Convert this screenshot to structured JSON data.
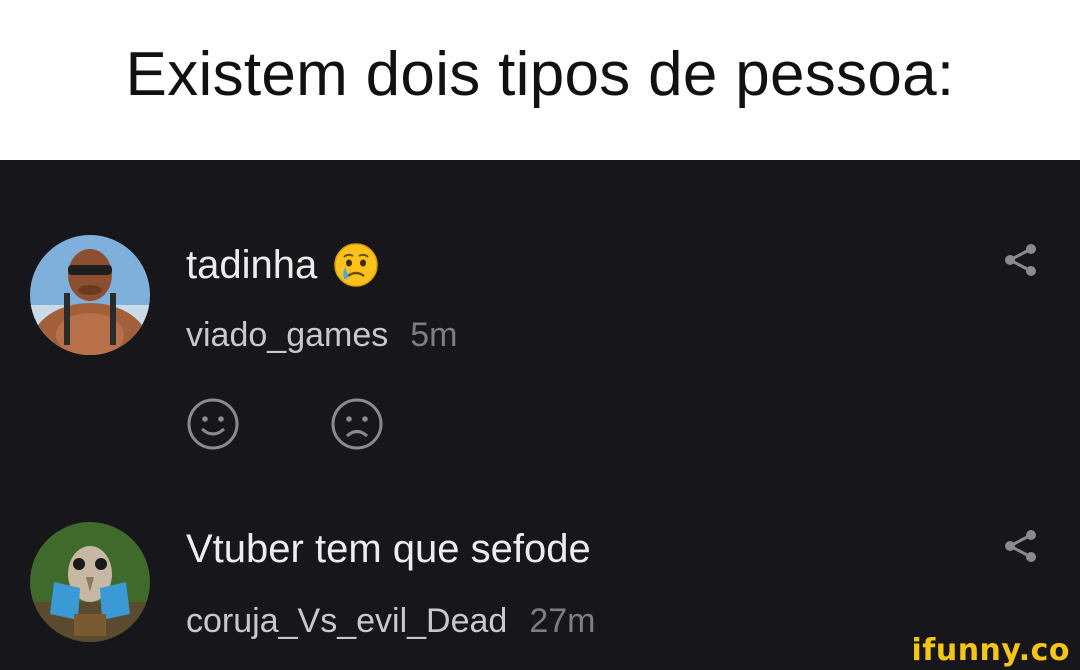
{
  "header": {
    "title": "Existem dois tipos de pessoa:"
  },
  "comments": [
    {
      "text": "tadinha",
      "emoji": "crying-face",
      "username": "viado_games",
      "time": "5m"
    },
    {
      "text": "Vtuber tem que sefode",
      "username": "coruja_Vs_evil_Dead",
      "time": "27m"
    }
  ],
  "watermark": {
    "brand": "ifunny.co"
  },
  "colors": {
    "background": "#17171b",
    "header_bg": "#ffffff",
    "text": "#ededed",
    "time": "#7d7d85",
    "brand": "#f5c518"
  }
}
